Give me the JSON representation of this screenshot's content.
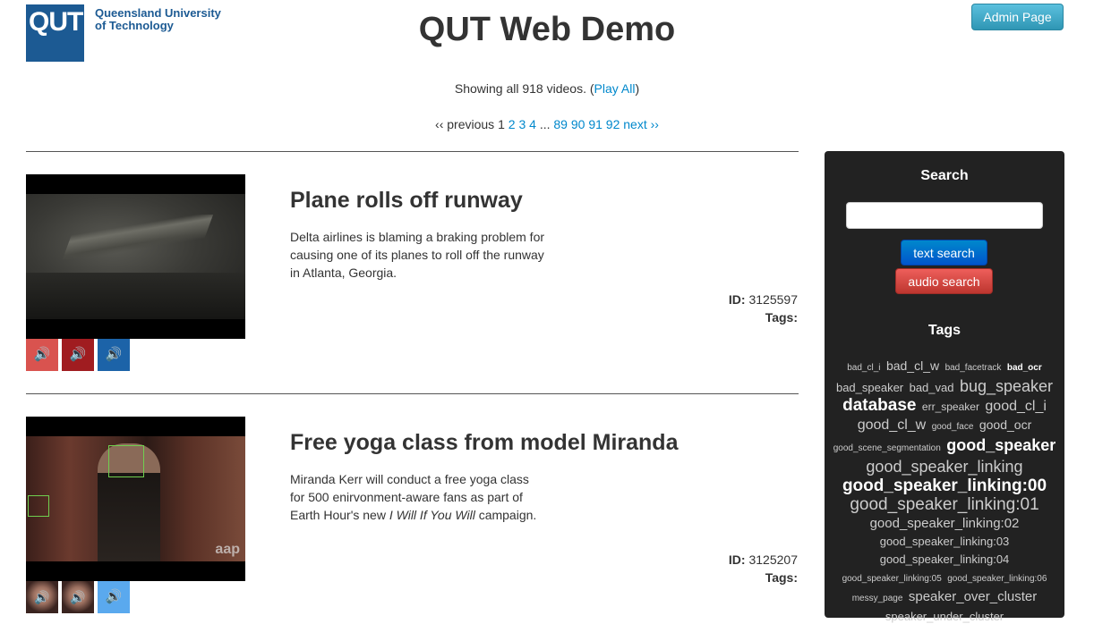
{
  "header": {
    "logo_mark": "QUT",
    "logo_text_line1": "Queensland University",
    "logo_text_line2": "of Technology",
    "title": "QUT Web Demo",
    "admin_label": "Admin Page"
  },
  "summary": {
    "showing_text": "Showing all 918 videos. (",
    "play_all": "Play All",
    "close_paren": ")"
  },
  "pagination": {
    "previous": "‹‹ previous",
    "current": "1",
    "pages_a": [
      "2",
      "3",
      "4"
    ],
    "ellipsis": "...",
    "pages_b": [
      "89",
      "90",
      "91",
      "92"
    ],
    "next": "next ››"
  },
  "videos": [
    {
      "title": "Plane rolls off runway",
      "description": "Delta airlines is blaming a braking problem for causing one of its planes to roll off the runway in Atlanta, Georgia.",
      "id_label": "ID:",
      "id": "3125597",
      "tags_label": "Tags:",
      "speaker_colors": [
        "#d9534f",
        "#a01c20",
        "#1c63a8"
      ]
    },
    {
      "title": "Free yoga class from model Miranda",
      "description_a": "Miranda Kerr will conduct a free yoga class for 500 enirvonment-aware fans as part of Earth Hour's new ",
      "description_em": "I Will If You Will",
      "description_b": " campaign.",
      "thumb_badge": "aap",
      "id_label": "ID:",
      "id": "3125207",
      "tags_label": "Tags:",
      "speaker_color": "#5aa9ee"
    }
  ],
  "icons": {
    "speaker": "🔊"
  },
  "sidebar": {
    "search_title": "Search",
    "search_value": "",
    "text_search": "text search",
    "audio_search": "audio search",
    "tags_title": "Tags",
    "tags": [
      {
        "name": "bad_cl_i",
        "size": 10,
        "bold": false
      },
      {
        "name": "bad_cl_w",
        "size": 14,
        "bold": false
      },
      {
        "name": "bad_facetrack",
        "size": 10,
        "bold": false
      },
      {
        "name": "bad_ocr",
        "size": 10,
        "bold": true
      },
      {
        "name": "bad_speaker",
        "size": 13,
        "bold": false
      },
      {
        "name": "bad_vad",
        "size": 13,
        "bold": false
      },
      {
        "name": "bug_speaker",
        "size": 18,
        "bold": false
      },
      {
        "name": "database",
        "size": 19,
        "bold": true
      },
      {
        "name": "err_speaker",
        "size": 12,
        "bold": false
      },
      {
        "name": "good_cl_i",
        "size": 16,
        "bold": false
      },
      {
        "name": "good_cl_w",
        "size": 16,
        "bold": false
      },
      {
        "name": "good_face",
        "size": 10,
        "bold": false
      },
      {
        "name": "good_ocr",
        "size": 14,
        "bold": false
      },
      {
        "name": "good_scene_segmentation",
        "size": 10,
        "bold": false
      },
      {
        "name": "good_speaker",
        "size": 18,
        "bold": true
      },
      {
        "name": "good_speaker_linking",
        "size": 18,
        "bold": false
      },
      {
        "name": "good_speaker_linking:00",
        "size": 19,
        "bold": true
      },
      {
        "name": "good_speaker_linking:01",
        "size": 19,
        "bold": false
      },
      {
        "name": "good_speaker_linking:02",
        "size": 15,
        "bold": false
      },
      {
        "name": "good_speaker_linking:03",
        "size": 13,
        "bold": false
      },
      {
        "name": "good_speaker_linking:04",
        "size": 13,
        "bold": false
      },
      {
        "name": "good_speaker_linking:05",
        "size": 10,
        "bold": false
      },
      {
        "name": "good_speaker_linking:06",
        "size": 10,
        "bold": false
      },
      {
        "name": "messy_page",
        "size": 10,
        "bold": false
      },
      {
        "name": "speaker_over_cluster",
        "size": 15,
        "bold": false
      },
      {
        "name": "speaker_under_cluster",
        "size": 13,
        "bold": false
      }
    ]
  }
}
